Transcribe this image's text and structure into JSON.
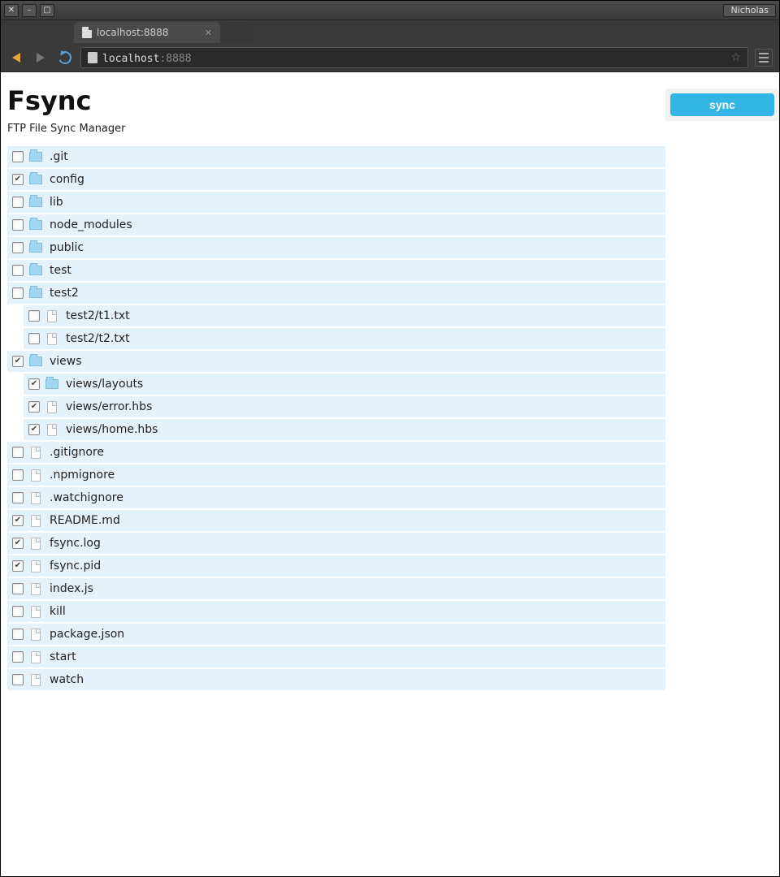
{
  "os": {
    "user_label": "Nicholas"
  },
  "browser": {
    "tab_title": "localhost:8888",
    "url_host": "localhost",
    "url_port": ":8888"
  },
  "app": {
    "title": "Fsync",
    "subtitle": "FTP File Sync Manager",
    "sync_button": "sync"
  },
  "tree": [
    {
      "name": ".git",
      "type": "folder",
      "checked": false,
      "level": 0
    },
    {
      "name": "config",
      "type": "folder",
      "checked": true,
      "level": 0
    },
    {
      "name": "lib",
      "type": "folder",
      "checked": false,
      "level": 0
    },
    {
      "name": "node_modules",
      "type": "folder",
      "checked": false,
      "level": 0
    },
    {
      "name": "public",
      "type": "folder",
      "checked": false,
      "level": 0
    },
    {
      "name": "test",
      "type": "folder",
      "checked": false,
      "level": 0
    },
    {
      "name": "test2",
      "type": "folder",
      "checked": false,
      "level": 0
    },
    {
      "name": "test2/t1.txt",
      "type": "file",
      "checked": false,
      "level": 1
    },
    {
      "name": "test2/t2.txt",
      "type": "file",
      "checked": false,
      "level": 1
    },
    {
      "name": "views",
      "type": "folder",
      "checked": true,
      "level": 0
    },
    {
      "name": "views/layouts",
      "type": "folder",
      "checked": true,
      "level": 1
    },
    {
      "name": "views/error.hbs",
      "type": "file",
      "checked": true,
      "level": 1
    },
    {
      "name": "views/home.hbs",
      "type": "file",
      "checked": true,
      "level": 1
    },
    {
      "name": ".gitignore",
      "type": "file",
      "checked": false,
      "level": 0
    },
    {
      "name": ".npmignore",
      "type": "file",
      "checked": false,
      "level": 0
    },
    {
      "name": ".watchignore",
      "type": "file",
      "checked": false,
      "level": 0
    },
    {
      "name": "README.md",
      "type": "file",
      "checked": true,
      "level": 0
    },
    {
      "name": "fsync.log",
      "type": "file",
      "checked": true,
      "level": 0
    },
    {
      "name": "fsync.pid",
      "type": "file",
      "checked": true,
      "level": 0
    },
    {
      "name": "index.js",
      "type": "file",
      "checked": false,
      "level": 0
    },
    {
      "name": "kill",
      "type": "file",
      "checked": false,
      "level": 0
    },
    {
      "name": "package.json",
      "type": "file",
      "checked": false,
      "level": 0
    },
    {
      "name": "start",
      "type": "file",
      "checked": false,
      "level": 0
    },
    {
      "name": "watch",
      "type": "file",
      "checked": false,
      "level": 0
    }
  ]
}
